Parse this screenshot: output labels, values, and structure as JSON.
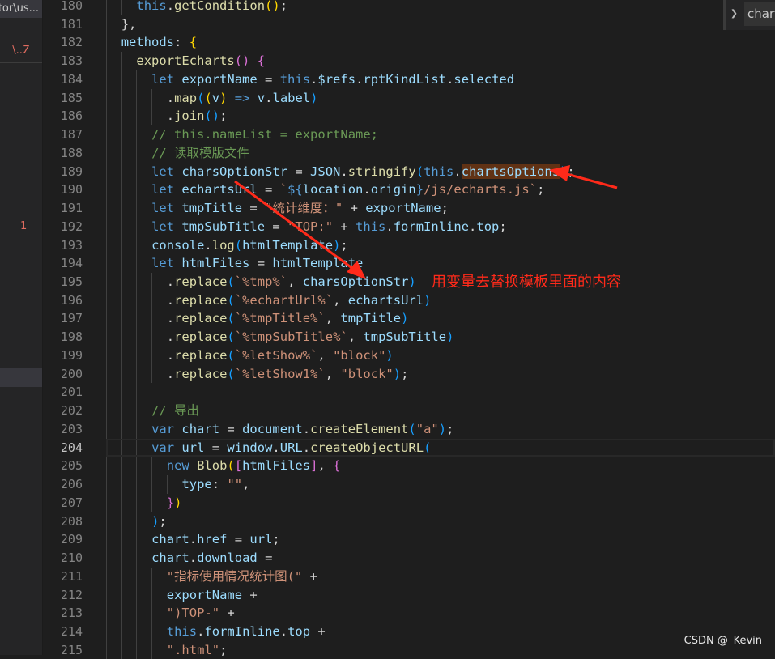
{
  "sidebar": {
    "top_item": "tor\\us...",
    "error_item": "\\...",
    "error_count": "7",
    "marker_count": "1"
  },
  "breadcrumb": {
    "item": "chart"
  },
  "editor": {
    "current_line": 204,
    "lines": [
      {
        "n": "180",
        "t": [
          [
            "ws",
            "    "
          ],
          [
            "t",
            "this"
          ],
          [
            "p",
            "."
          ],
          [
            "f",
            "getCondition"
          ],
          [
            "b1",
            "()"
          ],
          [
            "p",
            ";"
          ]
        ]
      },
      {
        "n": "181",
        "t": [
          [
            "ws",
            "  "
          ],
          [
            "p",
            "},"
          ]
        ]
      },
      {
        "n": "182",
        "t": [
          [
            "ws",
            "  "
          ],
          [
            "v",
            "methods"
          ],
          [
            "p",
            ": "
          ],
          [
            "b1",
            "{"
          ]
        ]
      },
      {
        "n": "183",
        "t": [
          [
            "ws",
            "    "
          ],
          [
            "f",
            "exportEcharts"
          ],
          [
            "b2",
            "()"
          ],
          [
            "p",
            " "
          ],
          [
            "b2",
            "{"
          ]
        ]
      },
      {
        "n": "184",
        "t": [
          [
            "ws",
            "      "
          ],
          [
            "k",
            "let"
          ],
          [
            "v",
            " exportName"
          ],
          [
            "p",
            " = "
          ],
          [
            "t",
            "this"
          ],
          [
            "p",
            "."
          ],
          [
            "v",
            "$refs"
          ],
          [
            "p",
            "."
          ],
          [
            "v",
            "rptKindList"
          ],
          [
            "p",
            "."
          ],
          [
            "v",
            "selected"
          ]
        ]
      },
      {
        "n": "185",
        "t": [
          [
            "ws",
            "        "
          ],
          [
            "p",
            "."
          ],
          [
            "f",
            "map"
          ],
          [
            "b3",
            "("
          ],
          [
            "b1",
            "("
          ],
          [
            "v",
            "v"
          ],
          [
            "b1",
            ")"
          ],
          [
            "k",
            " =>"
          ],
          [
            "v",
            " v"
          ],
          [
            "p",
            "."
          ],
          [
            "v",
            "label"
          ],
          [
            "b3",
            ")"
          ]
        ]
      },
      {
        "n": "186",
        "t": [
          [
            "ws",
            "        "
          ],
          [
            "p",
            "."
          ],
          [
            "f",
            "join"
          ],
          [
            "b3",
            "()"
          ],
          [
            "p",
            ";"
          ]
        ]
      },
      {
        "n": "187",
        "t": [
          [
            "ws",
            "      "
          ],
          [
            "c",
            "// this.nameList = exportName;"
          ]
        ]
      },
      {
        "n": "188",
        "t": [
          [
            "ws",
            "      "
          ],
          [
            "c",
            "// 读取模版文件"
          ]
        ]
      },
      {
        "n": "189",
        "t": [
          [
            "ws",
            "      "
          ],
          [
            "k",
            "let"
          ],
          [
            "v",
            " charsOptionStr"
          ],
          [
            "p",
            " = "
          ],
          [
            "v",
            "JSON"
          ],
          [
            "p",
            "."
          ],
          [
            "f",
            "stringify"
          ],
          [
            "b3",
            "("
          ],
          [
            "t",
            "this"
          ],
          [
            "p",
            "."
          ],
          [
            "h",
            "chartsOptions"
          ],
          [
            "b3",
            ")"
          ],
          [
            "p",
            ";"
          ]
        ]
      },
      {
        "n": "190",
        "t": [
          [
            "ws",
            "      "
          ],
          [
            "k",
            "let"
          ],
          [
            "v",
            " echartsUrl"
          ],
          [
            "p",
            " = "
          ],
          [
            "s",
            "`"
          ],
          [
            "k",
            "${"
          ],
          [
            "v",
            "location"
          ],
          [
            "p",
            "."
          ],
          [
            "v",
            "origin"
          ],
          [
            "k",
            "}"
          ],
          [
            "s",
            "/js/echarts.js`"
          ],
          [
            "p",
            ";"
          ]
        ]
      },
      {
        "n": "191",
        "t": [
          [
            "ws",
            "      "
          ],
          [
            "k",
            "let"
          ],
          [
            "v",
            " tmpTitle"
          ],
          [
            "p",
            " = "
          ],
          [
            "s",
            "\"统计维度：\""
          ],
          [
            "p",
            " + "
          ],
          [
            "v",
            "exportName"
          ],
          [
            "p",
            ";"
          ]
        ]
      },
      {
        "n": "192",
        "t": [
          [
            "ws",
            "      "
          ],
          [
            "k",
            "let"
          ],
          [
            "v",
            " tmpSubTitle"
          ],
          [
            "p",
            " = "
          ],
          [
            "s",
            "\"TOP:\""
          ],
          [
            "p",
            " + "
          ],
          [
            "t",
            "this"
          ],
          [
            "p",
            "."
          ],
          [
            "v",
            "formInline"
          ],
          [
            "p",
            "."
          ],
          [
            "v",
            "top"
          ],
          [
            "p",
            ";"
          ]
        ]
      },
      {
        "n": "193",
        "t": [
          [
            "ws",
            "      "
          ],
          [
            "v",
            "console"
          ],
          [
            "p",
            "."
          ],
          [
            "f",
            "log"
          ],
          [
            "b3",
            "("
          ],
          [
            "v",
            "htmlTemplate"
          ],
          [
            "b3",
            ")"
          ],
          [
            "p",
            ";"
          ]
        ]
      },
      {
        "n": "194",
        "t": [
          [
            "ws",
            "      "
          ],
          [
            "k",
            "let"
          ],
          [
            "v",
            " htmlFiles"
          ],
          [
            "p",
            " = "
          ],
          [
            "v",
            "htmlTemplate"
          ]
        ]
      },
      {
        "n": "195",
        "t": [
          [
            "ws",
            "        "
          ],
          [
            "p",
            "."
          ],
          [
            "f",
            "replace"
          ],
          [
            "b3",
            "("
          ],
          [
            "s",
            "`%tmp%`"
          ],
          [
            "p",
            ", "
          ],
          [
            "v",
            "charsOptionStr"
          ],
          [
            "b3",
            ")"
          ]
        ]
      },
      {
        "n": "196",
        "t": [
          [
            "ws",
            "        "
          ],
          [
            "p",
            "."
          ],
          [
            "f",
            "replace"
          ],
          [
            "b3",
            "("
          ],
          [
            "s",
            "`%echartUrl%`"
          ],
          [
            "p",
            ", "
          ],
          [
            "v",
            "echartsUrl"
          ],
          [
            "b3",
            ")"
          ]
        ]
      },
      {
        "n": "197",
        "t": [
          [
            "ws",
            "        "
          ],
          [
            "p",
            "."
          ],
          [
            "f",
            "replace"
          ],
          [
            "b3",
            "("
          ],
          [
            "s",
            "`%tmpTitle%`"
          ],
          [
            "p",
            ", "
          ],
          [
            "v",
            "tmpTitle"
          ],
          [
            "b3",
            ")"
          ]
        ]
      },
      {
        "n": "198",
        "t": [
          [
            "ws",
            "        "
          ],
          [
            "p",
            "."
          ],
          [
            "f",
            "replace"
          ],
          [
            "b3",
            "("
          ],
          [
            "s",
            "`%tmpSubTitle%`"
          ],
          [
            "p",
            ", "
          ],
          [
            "v",
            "tmpSubTitle"
          ],
          [
            "b3",
            ")"
          ]
        ]
      },
      {
        "n": "199",
        "t": [
          [
            "ws",
            "        "
          ],
          [
            "p",
            "."
          ],
          [
            "f",
            "replace"
          ],
          [
            "b3",
            "("
          ],
          [
            "s",
            "`%letShow%`"
          ],
          [
            "p",
            ", "
          ],
          [
            "s",
            "\"block\""
          ],
          [
            "b3",
            ")"
          ]
        ]
      },
      {
        "n": "200",
        "t": [
          [
            "ws",
            "        "
          ],
          [
            "p",
            "."
          ],
          [
            "f",
            "replace"
          ],
          [
            "b3",
            "("
          ],
          [
            "s",
            "`%letShow1%`"
          ],
          [
            "p",
            ", "
          ],
          [
            "s",
            "\"block\""
          ],
          [
            "b3",
            ")"
          ],
          [
            "p",
            ";"
          ]
        ]
      },
      {
        "n": "201",
        "t": [
          [
            "ws",
            "      "
          ]
        ]
      },
      {
        "n": "202",
        "t": [
          [
            "ws",
            "      "
          ],
          [
            "c",
            "// 导出"
          ]
        ]
      },
      {
        "n": "203",
        "t": [
          [
            "ws",
            "      "
          ],
          [
            "k",
            "var"
          ],
          [
            "v",
            " chart"
          ],
          [
            "p",
            " = "
          ],
          [
            "v",
            "document"
          ],
          [
            "p",
            "."
          ],
          [
            "f",
            "createElement"
          ],
          [
            "b3",
            "("
          ],
          [
            "s",
            "\"a\""
          ],
          [
            "b3",
            ")"
          ],
          [
            "p",
            ";"
          ]
        ]
      },
      {
        "n": "204",
        "t": [
          [
            "ws",
            "      "
          ],
          [
            "k",
            "var"
          ],
          [
            "v",
            " url"
          ],
          [
            "p",
            " = "
          ],
          [
            "v",
            "window"
          ],
          [
            "p",
            "."
          ],
          [
            "v",
            "URL"
          ],
          [
            "p",
            "."
          ],
          [
            "f",
            "createObjectURL"
          ],
          [
            "b3",
            "("
          ]
        ]
      },
      {
        "n": "205",
        "t": [
          [
            "ws",
            "        "
          ],
          [
            "k",
            "new"
          ],
          [
            "f",
            " Blob"
          ],
          [
            "b1",
            "("
          ],
          [
            "b2",
            "["
          ],
          [
            "v",
            "htmlFiles"
          ],
          [
            "b2",
            "]"
          ],
          [
            "p",
            ", "
          ],
          [
            "b2",
            "{"
          ]
        ]
      },
      {
        "n": "206",
        "t": [
          [
            "ws",
            "          "
          ],
          [
            "v",
            "type"
          ],
          [
            "p",
            ": "
          ],
          [
            "s",
            "\"\""
          ],
          [
            "p",
            ","
          ]
        ]
      },
      {
        "n": "207",
        "t": [
          [
            "ws",
            "        "
          ],
          [
            "b2",
            "}"
          ],
          [
            "b1",
            ")"
          ]
        ]
      },
      {
        "n": "208",
        "t": [
          [
            "ws",
            "      "
          ],
          [
            "b3",
            ")"
          ],
          [
            "p",
            ";"
          ]
        ]
      },
      {
        "n": "209",
        "t": [
          [
            "ws",
            "      "
          ],
          [
            "v",
            "chart"
          ],
          [
            "p",
            "."
          ],
          [
            "v",
            "href"
          ],
          [
            "p",
            " = "
          ],
          [
            "v",
            "url"
          ],
          [
            "p",
            ";"
          ]
        ]
      },
      {
        "n": "210",
        "t": [
          [
            "ws",
            "      "
          ],
          [
            "v",
            "chart"
          ],
          [
            "p",
            "."
          ],
          [
            "v",
            "download"
          ],
          [
            "p",
            " ="
          ]
        ]
      },
      {
        "n": "211",
        "t": [
          [
            "ws",
            "        "
          ],
          [
            "s",
            "\"指标使用情况统计图(\""
          ],
          [
            "p",
            " +"
          ]
        ]
      },
      {
        "n": "212",
        "t": [
          [
            "ws",
            "        "
          ],
          [
            "v",
            "exportName"
          ],
          [
            "p",
            " +"
          ]
        ]
      },
      {
        "n": "213",
        "t": [
          [
            "ws",
            "        "
          ],
          [
            "s",
            "\")TOP-\""
          ],
          [
            "p",
            " +"
          ]
        ]
      },
      {
        "n": "214",
        "t": [
          [
            "ws",
            "        "
          ],
          [
            "t",
            "this"
          ],
          [
            "p",
            "."
          ],
          [
            "v",
            "formInline"
          ],
          [
            "p",
            "."
          ],
          [
            "v",
            "top"
          ],
          [
            "p",
            " +"
          ]
        ]
      },
      {
        "n": "215",
        "t": [
          [
            "ws",
            "        "
          ],
          [
            "s",
            "\".html\""
          ],
          [
            "p",
            ";"
          ]
        ]
      }
    ]
  },
  "annotation": {
    "text": "用变量去替换模板里面的内容",
    "color": "#ff2a1a"
  },
  "watermark": "CSDN @  Kevin"
}
